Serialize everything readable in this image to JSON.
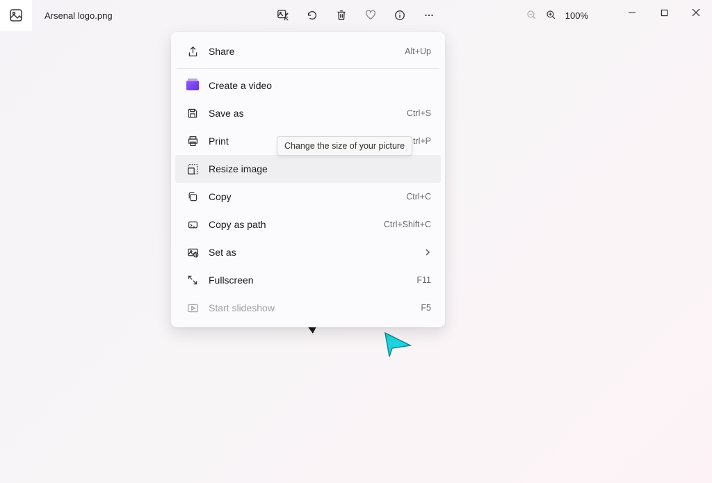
{
  "titlebar": {
    "filename": "Arsenal logo.png",
    "zoom": "100%"
  },
  "toolbar_icons": {
    "edit": "edit-image-icon",
    "rotate": "rotate-icon",
    "delete": "trash-icon",
    "favorite": "heart-icon",
    "info": "info-icon",
    "more": "more-icon",
    "zoom_out": "zoom-out-icon",
    "zoom_in": "zoom-in-icon"
  },
  "tooltip": "Change the size of your picture",
  "menu": {
    "items": [
      {
        "label": "Share",
        "shortcut": "Alt+Up",
        "disabled": false
      },
      {
        "label": "Create a video",
        "shortcut": "",
        "disabled": false
      },
      {
        "label": "Save as",
        "shortcut": "Ctrl+S",
        "disabled": false
      },
      {
        "label": "Print",
        "shortcut": "Ctrl+P",
        "disabled": false
      },
      {
        "label": "Resize image",
        "shortcut": "",
        "disabled": false
      },
      {
        "label": "Copy",
        "shortcut": "Ctrl+C",
        "disabled": false
      },
      {
        "label": "Copy as path",
        "shortcut": "Ctrl+Shift+C",
        "disabled": false
      },
      {
        "label": "Set as",
        "shortcut": "",
        "submenu": true,
        "disabled": false
      },
      {
        "label": "Fullscreen",
        "shortcut": "F11",
        "disabled": false
      },
      {
        "label": "Start slideshow",
        "shortcut": "F5",
        "disabled": true
      }
    ]
  }
}
